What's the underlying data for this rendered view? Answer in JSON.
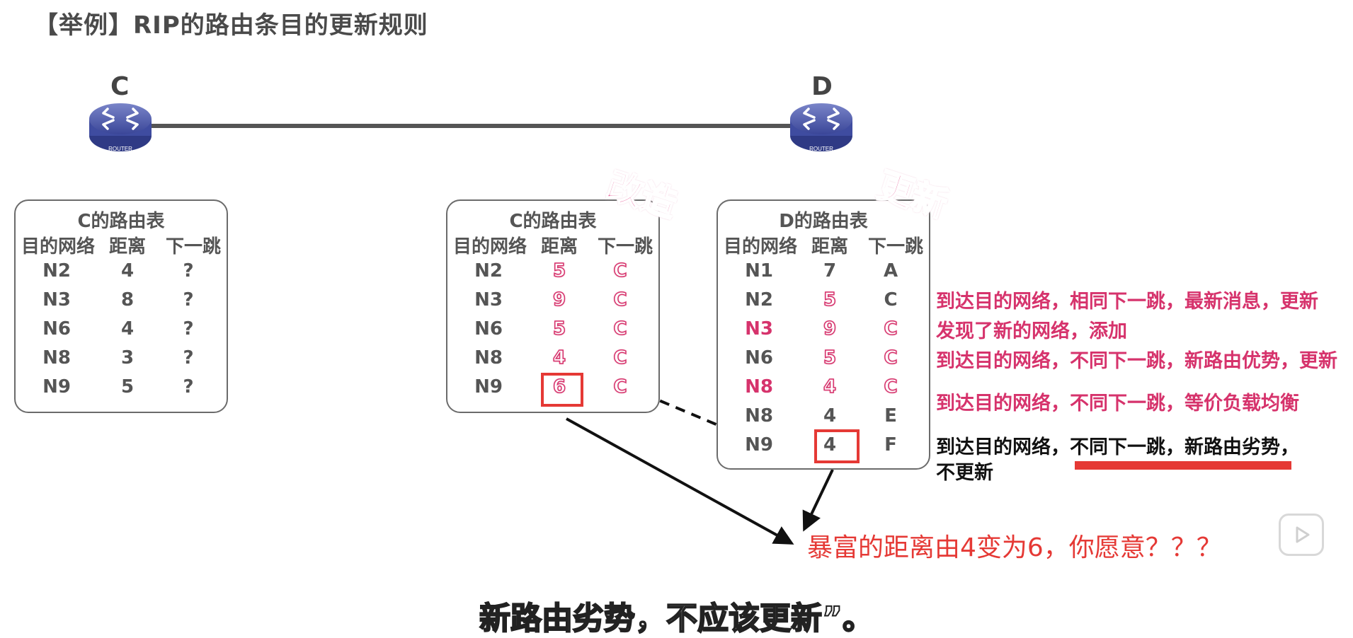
{
  "title": "【举例】RIP的路由条目的更新规则",
  "routers": {
    "c_label": "C",
    "d_label": "D",
    "device_text": "ROUTER"
  },
  "table1": {
    "title": "C的路由表",
    "headers": [
      "目的网络",
      "距离",
      "下一跳"
    ],
    "rows": [
      [
        "N2",
        "4",
        "?"
      ],
      [
        "N3",
        "8",
        "?"
      ],
      [
        "N6",
        "4",
        "?"
      ],
      [
        "N8",
        "3",
        "?"
      ],
      [
        "N9",
        "5",
        "?"
      ]
    ]
  },
  "table2": {
    "title": "C的路由表",
    "stamp": "改造",
    "headers": [
      "目的网络",
      "距离",
      "下一跳"
    ],
    "rows": [
      [
        "N2",
        "5",
        "C"
      ],
      [
        "N3",
        "9",
        "C"
      ],
      [
        "N6",
        "5",
        "C"
      ],
      [
        "N8",
        "4",
        "C"
      ],
      [
        "N9",
        "6",
        "C"
      ]
    ]
  },
  "table3": {
    "title": "D的路由表",
    "stamp": "更新",
    "headers": [
      "目的网络",
      "距离",
      "下一跳"
    ],
    "rows": [
      [
        "N1",
        "7",
        "A"
      ],
      [
        "N2",
        "5",
        "C"
      ],
      [
        "N3",
        "9",
        "C"
      ],
      [
        "N6",
        "5",
        "C"
      ],
      [
        "N8",
        "4",
        "C"
      ],
      [
        "N8",
        "4",
        "E"
      ],
      [
        "N9",
        "4",
        "F"
      ]
    ]
  },
  "notes": [
    "到达目的网络，相同下一跳，最新消息，更新",
    "发现了新的网络，添加",
    "到达目的网络，不同下一跳，新路由优势，更新",
    "到达目的网络，不同下一跳，等价负载均衡",
    "到达目的网络，不同下一跳，新路由劣势，",
    "不更新"
  ],
  "question": "暴富的距离由4变为6，你愿意？？？",
  "subtitle": "新路由劣势，不应该更新”。"
}
